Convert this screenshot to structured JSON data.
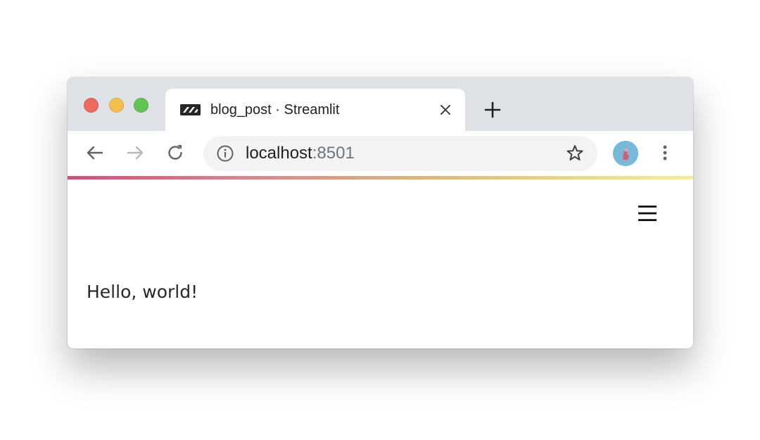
{
  "browser": {
    "tab": {
      "title": "blog_post · Streamlit",
      "favicon": "streamlit-logo-icon",
      "close_icon": "close-icon"
    },
    "new_tab_icon": "plus-icon",
    "toolbar": {
      "back_icon": "arrow-left-icon",
      "forward_icon": "arrow-right-icon",
      "reload_icon": "reload-icon",
      "site_info_icon": "info-icon",
      "url_host": "localhost",
      "url_port": ":8501",
      "bookmark_icon": "star-icon",
      "profile_icon": "avatar",
      "menu_icon": "kebab-menu-icon"
    },
    "colors": {
      "tabstrip": "#dee1e6",
      "omnibox": "#f1f3f4",
      "close_light": "#ec6a5e",
      "minimize_light": "#f4bf4f",
      "maximize_light": "#61c554"
    }
  },
  "app": {
    "menu_icon": "hamburger-menu-icon",
    "body_text": "Hello, world!"
  }
}
